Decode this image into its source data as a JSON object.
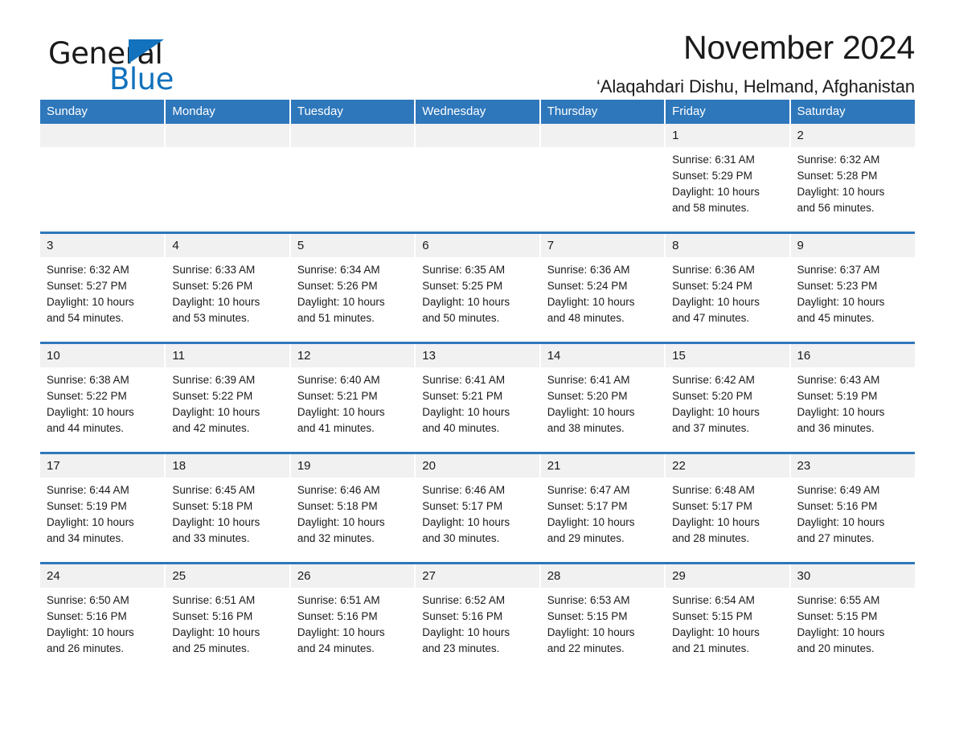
{
  "brand": {
    "name_part1": "General",
    "name_part2": "Blue",
    "triangle_icon": "triangle-icon",
    "accent_color": "#1272bd"
  },
  "header": {
    "title": "November 2024",
    "subtitle": "‘Alaqahdari Dishu, Helmand, Afghanistan"
  },
  "colors": {
    "header_blue": "#2e77bb",
    "daynum_gray": "#f1f1f1",
    "text": "#1a1a1a"
  },
  "weekday_headers": [
    "Sunday",
    "Monday",
    "Tuesday",
    "Wednesday",
    "Thursday",
    "Friday",
    "Saturday"
  ],
  "weeks": [
    [
      {
        "day": "",
        "sunrise": "",
        "sunset": "",
        "daylight_1": "",
        "daylight_2": ""
      },
      {
        "day": "",
        "sunrise": "",
        "sunset": "",
        "daylight_1": "",
        "daylight_2": ""
      },
      {
        "day": "",
        "sunrise": "",
        "sunset": "",
        "daylight_1": "",
        "daylight_2": ""
      },
      {
        "day": "",
        "sunrise": "",
        "sunset": "",
        "daylight_1": "",
        "daylight_2": ""
      },
      {
        "day": "",
        "sunrise": "",
        "sunset": "",
        "daylight_1": "",
        "daylight_2": ""
      },
      {
        "day": "1",
        "sunrise": "Sunrise: 6:31 AM",
        "sunset": "Sunset: 5:29 PM",
        "daylight_1": "Daylight: 10 hours",
        "daylight_2": "and 58 minutes."
      },
      {
        "day": "2",
        "sunrise": "Sunrise: 6:32 AM",
        "sunset": "Sunset: 5:28 PM",
        "daylight_1": "Daylight: 10 hours",
        "daylight_2": "and 56 minutes."
      }
    ],
    [
      {
        "day": "3",
        "sunrise": "Sunrise: 6:32 AM",
        "sunset": "Sunset: 5:27 PM",
        "daylight_1": "Daylight: 10 hours",
        "daylight_2": "and 54 minutes."
      },
      {
        "day": "4",
        "sunrise": "Sunrise: 6:33 AM",
        "sunset": "Sunset: 5:26 PM",
        "daylight_1": "Daylight: 10 hours",
        "daylight_2": "and 53 minutes."
      },
      {
        "day": "5",
        "sunrise": "Sunrise: 6:34 AM",
        "sunset": "Sunset: 5:26 PM",
        "daylight_1": "Daylight: 10 hours",
        "daylight_2": "and 51 minutes."
      },
      {
        "day": "6",
        "sunrise": "Sunrise: 6:35 AM",
        "sunset": "Sunset: 5:25 PM",
        "daylight_1": "Daylight: 10 hours",
        "daylight_2": "and 50 minutes."
      },
      {
        "day": "7",
        "sunrise": "Sunrise: 6:36 AM",
        "sunset": "Sunset: 5:24 PM",
        "daylight_1": "Daylight: 10 hours",
        "daylight_2": "and 48 minutes."
      },
      {
        "day": "8",
        "sunrise": "Sunrise: 6:36 AM",
        "sunset": "Sunset: 5:24 PM",
        "daylight_1": "Daylight: 10 hours",
        "daylight_2": "and 47 minutes."
      },
      {
        "day": "9",
        "sunrise": "Sunrise: 6:37 AM",
        "sunset": "Sunset: 5:23 PM",
        "daylight_1": "Daylight: 10 hours",
        "daylight_2": "and 45 minutes."
      }
    ],
    [
      {
        "day": "10",
        "sunrise": "Sunrise: 6:38 AM",
        "sunset": "Sunset: 5:22 PM",
        "daylight_1": "Daylight: 10 hours",
        "daylight_2": "and 44 minutes."
      },
      {
        "day": "11",
        "sunrise": "Sunrise: 6:39 AM",
        "sunset": "Sunset: 5:22 PM",
        "daylight_1": "Daylight: 10 hours",
        "daylight_2": "and 42 minutes."
      },
      {
        "day": "12",
        "sunrise": "Sunrise: 6:40 AM",
        "sunset": "Sunset: 5:21 PM",
        "daylight_1": "Daylight: 10 hours",
        "daylight_2": "and 41 minutes."
      },
      {
        "day": "13",
        "sunrise": "Sunrise: 6:41 AM",
        "sunset": "Sunset: 5:21 PM",
        "daylight_1": "Daylight: 10 hours",
        "daylight_2": "and 40 minutes."
      },
      {
        "day": "14",
        "sunrise": "Sunrise: 6:41 AM",
        "sunset": "Sunset: 5:20 PM",
        "daylight_1": "Daylight: 10 hours",
        "daylight_2": "and 38 minutes."
      },
      {
        "day": "15",
        "sunrise": "Sunrise: 6:42 AM",
        "sunset": "Sunset: 5:20 PM",
        "daylight_1": "Daylight: 10 hours",
        "daylight_2": "and 37 minutes."
      },
      {
        "day": "16",
        "sunrise": "Sunrise: 6:43 AM",
        "sunset": "Sunset: 5:19 PM",
        "daylight_1": "Daylight: 10 hours",
        "daylight_2": "and 36 minutes."
      }
    ],
    [
      {
        "day": "17",
        "sunrise": "Sunrise: 6:44 AM",
        "sunset": "Sunset: 5:19 PM",
        "daylight_1": "Daylight: 10 hours",
        "daylight_2": "and 34 minutes."
      },
      {
        "day": "18",
        "sunrise": "Sunrise: 6:45 AM",
        "sunset": "Sunset: 5:18 PM",
        "daylight_1": "Daylight: 10 hours",
        "daylight_2": "and 33 minutes."
      },
      {
        "day": "19",
        "sunrise": "Sunrise: 6:46 AM",
        "sunset": "Sunset: 5:18 PM",
        "daylight_1": "Daylight: 10 hours",
        "daylight_2": "and 32 minutes."
      },
      {
        "day": "20",
        "sunrise": "Sunrise: 6:46 AM",
        "sunset": "Sunset: 5:17 PM",
        "daylight_1": "Daylight: 10 hours",
        "daylight_2": "and 30 minutes."
      },
      {
        "day": "21",
        "sunrise": "Sunrise: 6:47 AM",
        "sunset": "Sunset: 5:17 PM",
        "daylight_1": "Daylight: 10 hours",
        "daylight_2": "and 29 minutes."
      },
      {
        "day": "22",
        "sunrise": "Sunrise: 6:48 AM",
        "sunset": "Sunset: 5:17 PM",
        "daylight_1": "Daylight: 10 hours",
        "daylight_2": "and 28 minutes."
      },
      {
        "day": "23",
        "sunrise": "Sunrise: 6:49 AM",
        "sunset": "Sunset: 5:16 PM",
        "daylight_1": "Daylight: 10 hours",
        "daylight_2": "and 27 minutes."
      }
    ],
    [
      {
        "day": "24",
        "sunrise": "Sunrise: 6:50 AM",
        "sunset": "Sunset: 5:16 PM",
        "daylight_1": "Daylight: 10 hours",
        "daylight_2": "and 26 minutes."
      },
      {
        "day": "25",
        "sunrise": "Sunrise: 6:51 AM",
        "sunset": "Sunset: 5:16 PM",
        "daylight_1": "Daylight: 10 hours",
        "daylight_2": "and 25 minutes."
      },
      {
        "day": "26",
        "sunrise": "Sunrise: 6:51 AM",
        "sunset": "Sunset: 5:16 PM",
        "daylight_1": "Daylight: 10 hours",
        "daylight_2": "and 24 minutes."
      },
      {
        "day": "27",
        "sunrise": "Sunrise: 6:52 AM",
        "sunset": "Sunset: 5:16 PM",
        "daylight_1": "Daylight: 10 hours",
        "daylight_2": "and 23 minutes."
      },
      {
        "day": "28",
        "sunrise": "Sunrise: 6:53 AM",
        "sunset": "Sunset: 5:15 PM",
        "daylight_1": "Daylight: 10 hours",
        "daylight_2": "and 22 minutes."
      },
      {
        "day": "29",
        "sunrise": "Sunrise: 6:54 AM",
        "sunset": "Sunset: 5:15 PM",
        "daylight_1": "Daylight: 10 hours",
        "daylight_2": "and 21 minutes."
      },
      {
        "day": "30",
        "sunrise": "Sunrise: 6:55 AM",
        "sunset": "Sunset: 5:15 PM",
        "daylight_1": "Daylight: 10 hours",
        "daylight_2": "and 20 minutes."
      }
    ]
  ]
}
